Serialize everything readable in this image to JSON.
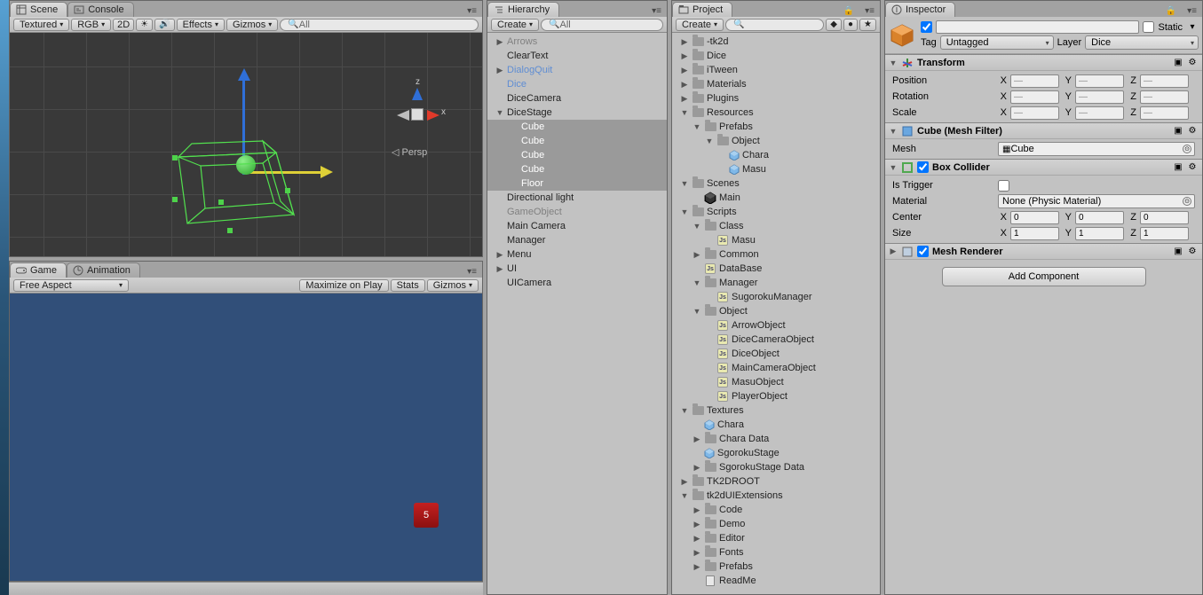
{
  "sceneTab": "Scene",
  "consoleTab": "Console",
  "gameTab": "Game",
  "animationTab": "Animation",
  "hierarchyTab": "Hierarchy",
  "projectTab": "Project",
  "inspectorTab": "Inspector",
  "sceneToolbar": {
    "renderMode": "Textured",
    "colorMode": "RGB",
    "mode2d": "2D",
    "effects": "Effects",
    "gizmos": "Gizmos",
    "search": "All"
  },
  "gizmoLabels": {
    "x": "x",
    "z": "z",
    "persp": "Persp"
  },
  "gameToolbar": {
    "aspect": "Free Aspect",
    "maximize": "Maximize on Play",
    "stats": "Stats",
    "gizmos": "Gizmos"
  },
  "diceValue": "5",
  "hierarchy": {
    "create": "Create",
    "search": "All",
    "items": [
      {
        "d": 0,
        "f": "right",
        "t": "Arrows",
        "cls": "grey"
      },
      {
        "d": 0,
        "f": "",
        "t": "ClearText"
      },
      {
        "d": 0,
        "f": "right",
        "t": "DialogQuit",
        "cls": "blue"
      },
      {
        "d": 0,
        "f": "",
        "t": "Dice",
        "cls": "blue"
      },
      {
        "d": 0,
        "f": "",
        "t": "DiceCamera"
      },
      {
        "d": 0,
        "f": "down",
        "t": "DiceStage"
      },
      {
        "d": 1,
        "f": "",
        "t": "Cube",
        "sel": true
      },
      {
        "d": 1,
        "f": "",
        "t": "Cube",
        "sel": true
      },
      {
        "d": 1,
        "f": "",
        "t": "Cube",
        "sel": true
      },
      {
        "d": 1,
        "f": "",
        "t": "Cube",
        "sel": true
      },
      {
        "d": 1,
        "f": "",
        "t": "Floor",
        "sel": true
      },
      {
        "d": 0,
        "f": "",
        "t": "Directional light"
      },
      {
        "d": 0,
        "f": "",
        "t": "GameObject",
        "cls": "grey"
      },
      {
        "d": 0,
        "f": "",
        "t": "Main Camera"
      },
      {
        "d": 0,
        "f": "",
        "t": "Manager"
      },
      {
        "d": 0,
        "f": "right",
        "t": "Menu"
      },
      {
        "d": 0,
        "f": "right",
        "t": "UI"
      },
      {
        "d": 0,
        "f": "",
        "t": "UICamera"
      }
    ]
  },
  "project": {
    "create": "Create",
    "items": [
      {
        "d": 0,
        "f": "right",
        "i": "folder",
        "t": "-tk2d"
      },
      {
        "d": 0,
        "f": "right",
        "i": "folder",
        "t": "Dice"
      },
      {
        "d": 0,
        "f": "right",
        "i": "folder",
        "t": "iTween"
      },
      {
        "d": 0,
        "f": "right",
        "i": "folder",
        "t": "Materials"
      },
      {
        "d": 0,
        "f": "right",
        "i": "folder",
        "t": "Plugins"
      },
      {
        "d": 0,
        "f": "down",
        "i": "folder",
        "t": "Resources"
      },
      {
        "d": 1,
        "f": "down",
        "i": "folder",
        "t": "Prefabs"
      },
      {
        "d": 2,
        "f": "down",
        "i": "folder",
        "t": "Object"
      },
      {
        "d": 3,
        "f": "",
        "i": "prefab",
        "t": "Chara"
      },
      {
        "d": 3,
        "f": "",
        "i": "prefab",
        "t": "Masu"
      },
      {
        "d": 0,
        "f": "down",
        "i": "folder",
        "t": "Scenes"
      },
      {
        "d": 1,
        "f": "",
        "i": "scene",
        "t": "Main"
      },
      {
        "d": 0,
        "f": "down",
        "i": "folder",
        "t": "Scripts"
      },
      {
        "d": 1,
        "f": "down",
        "i": "folder",
        "t": "Class"
      },
      {
        "d": 2,
        "f": "",
        "i": "js",
        "t": "Masu"
      },
      {
        "d": 1,
        "f": "right",
        "i": "folder",
        "t": "Common"
      },
      {
        "d": 1,
        "f": "",
        "i": "js",
        "t": "DataBase"
      },
      {
        "d": 1,
        "f": "down",
        "i": "folder",
        "t": "Manager"
      },
      {
        "d": 2,
        "f": "",
        "i": "js",
        "t": "SugorokuManager"
      },
      {
        "d": 1,
        "f": "down",
        "i": "folder",
        "t": "Object"
      },
      {
        "d": 2,
        "f": "",
        "i": "js",
        "t": "ArrowObject"
      },
      {
        "d": 2,
        "f": "",
        "i": "js",
        "t": "DiceCameraObject"
      },
      {
        "d": 2,
        "f": "",
        "i": "js",
        "t": "DiceObject"
      },
      {
        "d": 2,
        "f": "",
        "i": "js",
        "t": "MainCameraObject"
      },
      {
        "d": 2,
        "f": "",
        "i": "js",
        "t": "MasuObject"
      },
      {
        "d": 2,
        "f": "",
        "i": "js",
        "t": "PlayerObject"
      },
      {
        "d": 0,
        "f": "down",
        "i": "folder",
        "t": "Textures"
      },
      {
        "d": 1,
        "f": "",
        "i": "prefab",
        "t": "Chara"
      },
      {
        "d": 1,
        "f": "right",
        "i": "folder",
        "t": "Chara Data"
      },
      {
        "d": 1,
        "f": "",
        "i": "prefab",
        "t": "SgorokuStage"
      },
      {
        "d": 1,
        "f": "right",
        "i": "folder",
        "t": "SgorokuStage Data"
      },
      {
        "d": 0,
        "f": "right",
        "i": "folder",
        "t": "TK2DROOT"
      },
      {
        "d": 0,
        "f": "down",
        "i": "folder",
        "t": "tk2dUIExtensions"
      },
      {
        "d": 1,
        "f": "right",
        "i": "folder",
        "t": "Code"
      },
      {
        "d": 1,
        "f": "right",
        "i": "folder",
        "t": "Demo"
      },
      {
        "d": 1,
        "f": "right",
        "i": "folder",
        "t": "Editor"
      },
      {
        "d": 1,
        "f": "right",
        "i": "folder",
        "t": "Fonts"
      },
      {
        "d": 1,
        "f": "right",
        "i": "folder",
        "t": "Prefabs"
      },
      {
        "d": 1,
        "f": "",
        "i": "doc",
        "t": "ReadMe"
      }
    ]
  },
  "inspector": {
    "nameField": "",
    "static": "Static",
    "tagLabel": "Tag",
    "tagValue": "Untagged",
    "layerLabel": "Layer",
    "layerValue": "Dice",
    "transform": {
      "title": "Transform",
      "position": "Position",
      "rotation": "Rotation",
      "scale": "Scale",
      "dash": "—"
    },
    "meshfilter": {
      "title": "Cube (Mesh Filter)",
      "meshLabel": "Mesh",
      "meshValue": "Cube"
    },
    "boxcollider": {
      "title": "Box Collider",
      "isTrigger": "Is Trigger",
      "material": "Material",
      "materialValue": "None (Physic Material)",
      "center": "Center",
      "size": "Size",
      "cx": "0",
      "cy": "0",
      "cz": "0",
      "sx": "1",
      "sy": "1",
      "sz": "1"
    },
    "meshrenderer": {
      "title": "Mesh Renderer"
    },
    "addComponent": "Add Component",
    "axis": {
      "x": "X",
      "y": "Y",
      "z": "Z"
    }
  }
}
